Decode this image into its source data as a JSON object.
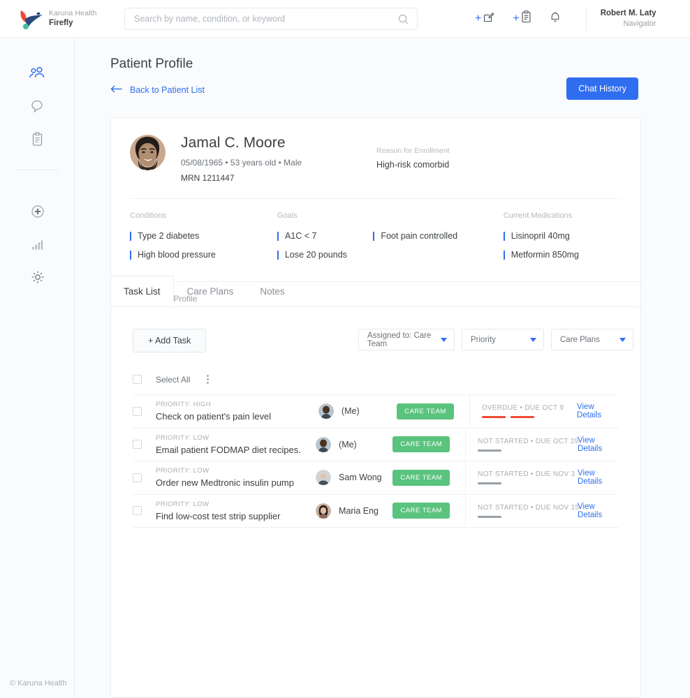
{
  "brand": {
    "company": "Karuna Health",
    "product": "Firefly",
    "logo_icon": "hummingbird-logo"
  },
  "search": {
    "placeholder": "Search by name, condition, or keyword",
    "value": "",
    "icon": "search-icon"
  },
  "topbar": {
    "new_message_icon": "compose-message-icon",
    "new_task_icon": "clipboard-plus-icon",
    "notifications_icon": "bell-icon",
    "plus": "+",
    "user_name": "Robert M. Laty",
    "user_role": "Navigator"
  },
  "sidebar": {
    "items": [
      {
        "icon": "people-icon",
        "name": "patients",
        "active": true
      },
      {
        "icon": "chat-bubble-icon",
        "name": "messages",
        "active": false
      },
      {
        "icon": "clipboard-icon",
        "name": "tasks",
        "active": false
      },
      {
        "icon": "plus-circle-icon",
        "name": "add",
        "active": false
      },
      {
        "icon": "bar-chart-icon",
        "name": "reports",
        "active": false
      },
      {
        "icon": "gear-icon",
        "name": "settings",
        "active": false
      }
    ],
    "footer": "© Karuna Health"
  },
  "page": {
    "title": "Patient Profile",
    "back_label": "Back to Patient List",
    "back_icon": "arrow-left-icon",
    "chat_history_label": "Chat History",
    "accent_blue": "#2f6ef0"
  },
  "patient": {
    "avatar_icon": "patient-avatar",
    "name": "Jamal C. Moore",
    "dob": "05/08/1965",
    "age": "53 years old",
    "sex": "Male",
    "meta": "05/08/1965  •  53 years old  •  Male",
    "mrn": "MRN 1211447",
    "reason_label": "Reason for Enrollment",
    "reason_value": "High-risk comorbid",
    "columns": {
      "conditions_header": "Conditions",
      "goals_header": "Goals",
      "medications_header": "Current Medications",
      "conditions": [
        "Type 2 diabetes",
        "High blood pressure"
      ],
      "goals": [
        "A1C < 7",
        "Lose 20 pounds"
      ],
      "goals2": [
        "Foot pain controlled"
      ],
      "medications": [
        "Lisinopril 40mg",
        "Metformin 850mg"
      ]
    },
    "show_profile_label": "Show Profile",
    "show_profile_icon": "chevron-down-icon"
  },
  "tabs": [
    {
      "label": "Task List",
      "active": true
    },
    {
      "label": "Care Plans",
      "active": false
    },
    {
      "label": "Notes",
      "active": false
    }
  ],
  "task_panel": {
    "add_task_label": "+ Add Task",
    "filters": [
      {
        "label": "Assigned to: Care Team",
        "icon": "chevron-down-icon"
      },
      {
        "label": "Priority",
        "icon": "chevron-down-icon"
      },
      {
        "label": "Care Plans",
        "icon": "chevron-down-icon"
      }
    ],
    "select_all_label": "Select All",
    "kebab_icon": "more-vertical-icon",
    "view_details_label": "View Details",
    "team_badge_label": "CARE TEAM",
    "overdue_color": "#f04a32",
    "normal_bar_color": "#9aa0a6",
    "rows": [
      {
        "priority": "PRIORITY: HIGH",
        "title": "Check on patient's pain level",
        "assignee": "(Me)",
        "avatar_icon": "avatar-me",
        "badge": "CARE TEAM",
        "status": "OVERDUE  •  DUE OCT 9",
        "bars": 2,
        "bar_color": "#f04a32",
        "view_details": "View Details"
      },
      {
        "priority": "PRIORITY: LOW",
        "title": "Email patient FODMAP diet recipes.",
        "assignee": "(Me)",
        "avatar_icon": "avatar-me",
        "badge": "CARE TEAM",
        "status": "NOT STARTED •  DUE OCT 29",
        "bars": 1,
        "bar_color": "#9aa0a6",
        "view_details": "View Details"
      },
      {
        "priority": "PRIORITY: LOW",
        "title": "Order new Medtronic insulin pump",
        "assignee": "Sam Wong",
        "avatar_icon": "avatar-sam-wong",
        "badge": "CARE TEAM",
        "status": "NOT STARTED •  DUE NOV 3",
        "bars": 1,
        "bar_color": "#9aa0a6",
        "view_details": "View Details"
      },
      {
        "priority": "PRIORITY: LOW",
        "title": "Find low-cost test strip supplier",
        "assignee": "Maria Eng",
        "avatar_icon": "avatar-maria-eng",
        "badge": "CARE TEAM",
        "status": "NOT STARTED •  DUE NOV 15",
        "bars": 1,
        "bar_color": "#9aa0a6",
        "view_details": "View Details"
      }
    ]
  }
}
